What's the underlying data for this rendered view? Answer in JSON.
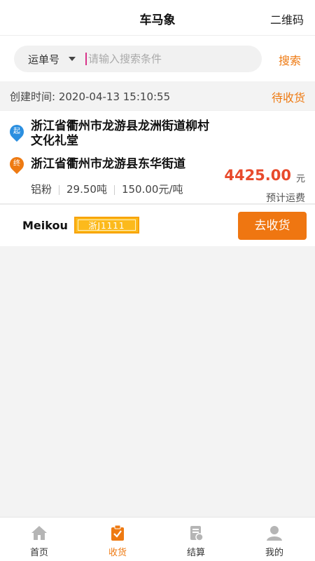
{
  "header": {
    "title": "车马象",
    "qr_label": "二维码"
  },
  "search": {
    "type_label": "运单号",
    "placeholder": "请输入搜索条件",
    "button_label": "搜索"
  },
  "order": {
    "created_label": "创建时间: 2020-04-13 15:10:55",
    "status": "待收货",
    "start_badge": "起",
    "end_badge": "终",
    "from_address": "浙江省衢州市龙游县龙洲街道柳村文化礼堂",
    "to_address": "浙江省衢州市龙游县东华街道",
    "price": "4425.00",
    "price_unit": "元",
    "price_label": "预计运费",
    "cargo_name": "铝粉",
    "cargo_weight": "29.50吨",
    "cargo_rate": "150.00元/吨",
    "company": "Meikou",
    "plate": "浙J1111",
    "action_label": "去收货"
  },
  "tabs": [
    {
      "label": "首页",
      "icon": "home-icon"
    },
    {
      "label": "收货",
      "icon": "receive-icon"
    },
    {
      "label": "结算",
      "icon": "settlement-icon"
    },
    {
      "label": "我的",
      "icon": "user-icon"
    }
  ],
  "colors": {
    "accent": "#ee7a12",
    "price": "#e84a2c",
    "start_pin": "#2b8fe0",
    "plate": "#fcba1c"
  }
}
